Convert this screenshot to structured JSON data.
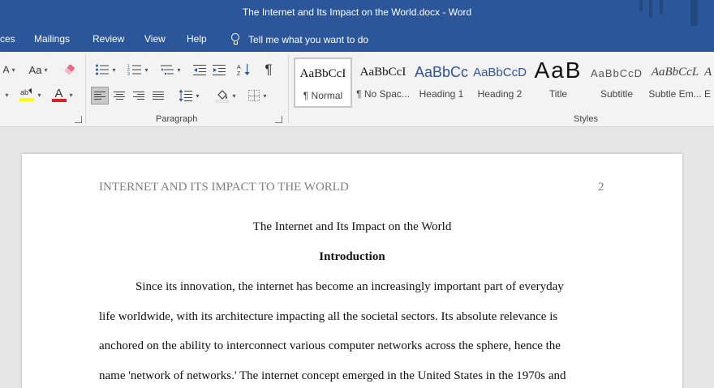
{
  "window": {
    "title": "The Internet and Its Impact on the World.docx  -  Word"
  },
  "tabs": {
    "references_partial": "ces",
    "mailings": "Mailings",
    "review": "Review",
    "view": "View",
    "help": "Help",
    "tell_me": "Tell me what you want to do"
  },
  "ribbon": {
    "font_group": {
      "change_case": "Aa",
      "clear_format_icon": "eraser-icon",
      "highlight_icon": "highlighter-icon",
      "font_color_letter": "A",
      "font_color": "#e02020",
      "highlight_color": "#ffff00"
    },
    "paragraph_group": {
      "label": "Paragraph",
      "pilcrow": "¶"
    },
    "styles_group": {
      "label": "Styles",
      "styles": [
        {
          "preview": "AaBbCcI",
          "name": "¶ Normal"
        },
        {
          "preview": "AaBbCcI",
          "name": "¶ No Spac..."
        },
        {
          "preview": "AaBbCc",
          "name": "Heading 1"
        },
        {
          "preview": "AaBbCcD",
          "name": "Heading 2"
        },
        {
          "preview": "AaB",
          "name": "Title"
        },
        {
          "preview": "AaBbCcD",
          "name": "Subtitle"
        },
        {
          "preview": "AaBbCcL",
          "name": "Subtle Em..."
        },
        {
          "preview": "A",
          "name": "E"
        }
      ]
    }
  },
  "document": {
    "running_head": "INTERNET AND ITS IMPACT TO THE WORLD",
    "page_number": "2",
    "title": "The Internet and Its Impact on the World",
    "heading": "Introduction",
    "lines": [
      "Since its innovation, the internet has become an increasingly important part of everyday",
      "life worldwide, with its architecture impacting all the societal sectors. Its absolute relevance is",
      "anchored on the ability to interconnect various computer networks across the sphere, hence the",
      "name 'network of networks.' The internet concept emerged in the United States in the 1970s and"
    ]
  }
}
